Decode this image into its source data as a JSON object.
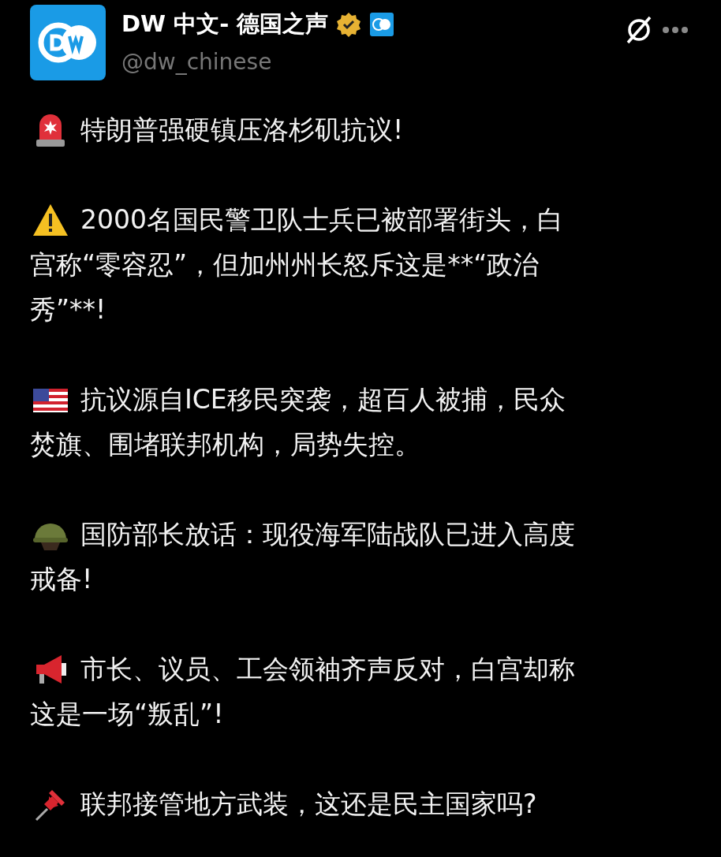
{
  "account": {
    "name": "DW 中文- 德国之声",
    "handle": "@dw_chinese",
    "verified": true
  },
  "paragraphs": [
    {
      "kind": "siren",
      "lines": [
        "特朗普强硬镇压洛杉矶抗议!"
      ]
    },
    {
      "kind": "warning",
      "lines": [
        "2000名国民警卫队士兵已被部署街头，白",
        "宫称“零容忍”，但加州州长怒斥这是**“政治",
        "秀”**!"
      ]
    },
    {
      "kind": "flag",
      "lines": [
        "抗议源自ICE移民突袭，超百人被捕，民众",
        "焚旗、围堵联邦机构，局势失控。"
      ]
    },
    {
      "kind": "helmet",
      "lines": [
        "国防部长放话：现役海军陆战队已进入高度",
        "戒备!"
      ]
    },
    {
      "kind": "megaphone",
      "lines": [
        "市长、议员、工会领袖齐声反对，白宫却称",
        "这是一场“叛乱”!"
      ]
    },
    {
      "kind": "pin",
      "lines": [
        "联邦接管地方武装，这还是民主国家吗?"
      ]
    }
  ]
}
